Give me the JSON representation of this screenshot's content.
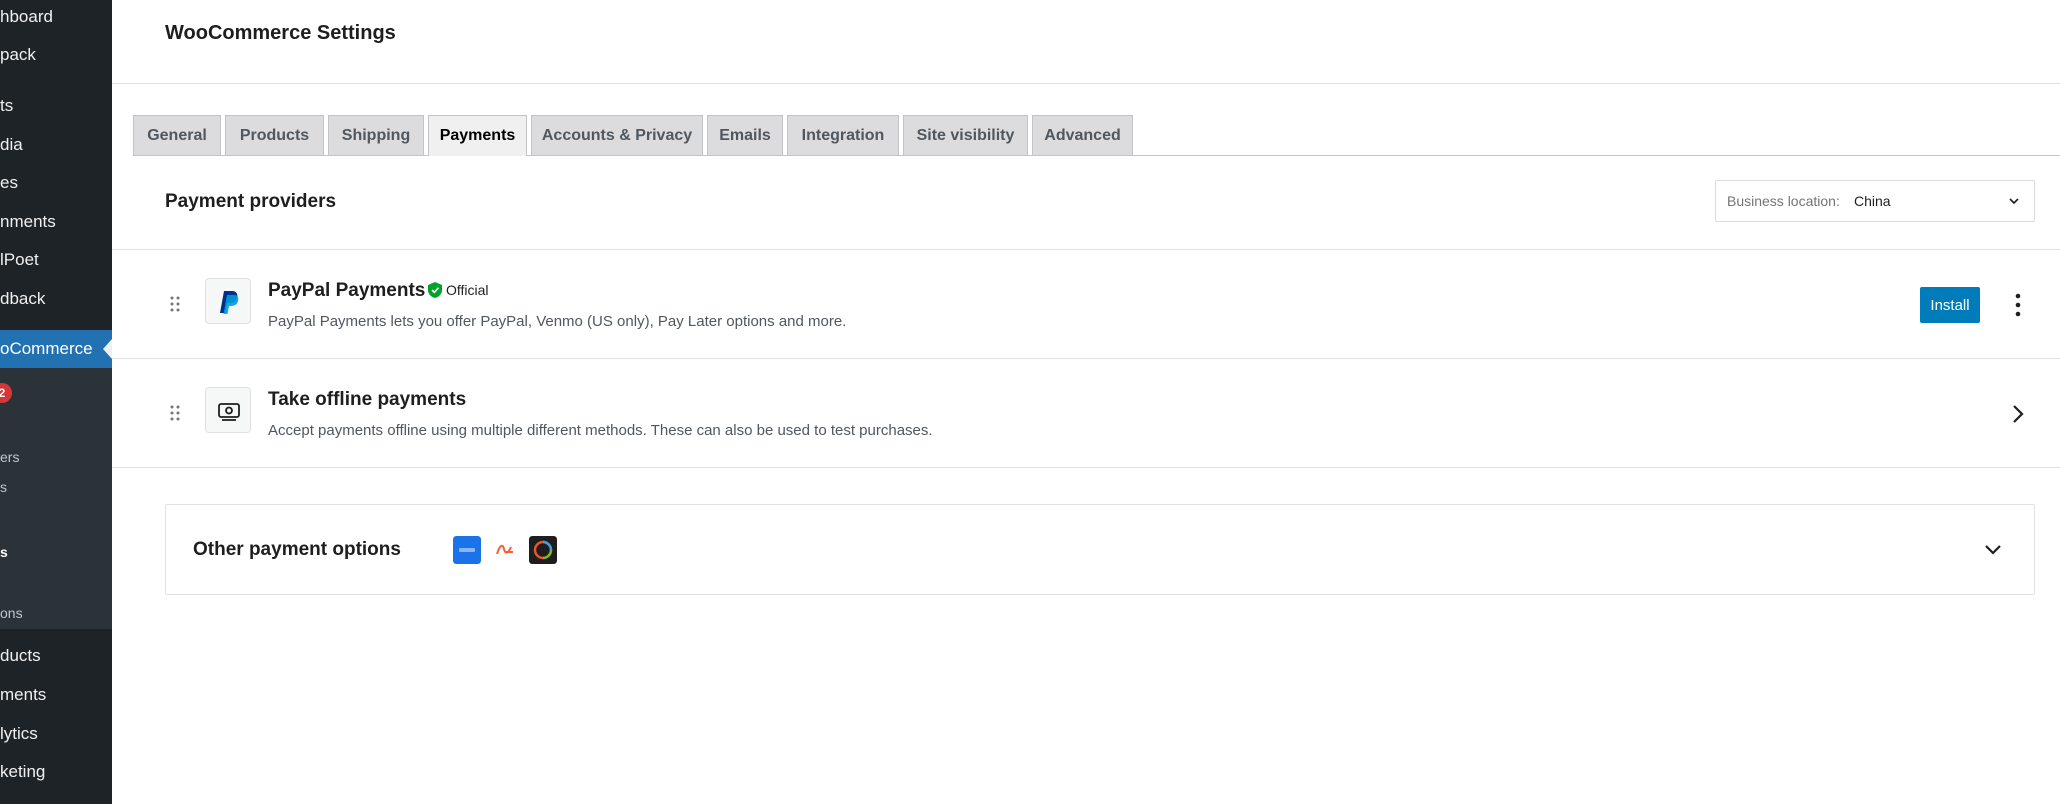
{
  "sidebar": {
    "items": [
      {
        "label": "hboard"
      },
      {
        "label": "pack"
      },
      {
        "label": "ts"
      },
      {
        "label": "dia"
      },
      {
        "label": "es"
      },
      {
        "label": "nments"
      },
      {
        "label": "lPoet"
      },
      {
        "label": "dback"
      },
      {
        "label": "oCommerce"
      },
      {
        "label": "2"
      },
      {
        "label": "ers"
      },
      {
        "label": "s"
      },
      {
        "label": "s"
      },
      {
        "label": "ons"
      },
      {
        "label": "ducts"
      },
      {
        "label": "ments"
      },
      {
        "label": "lytics"
      },
      {
        "label": "keting"
      }
    ]
  },
  "header": {
    "title": "WooCommerce Settings"
  },
  "tabs": [
    {
      "label": "General"
    },
    {
      "label": "Products"
    },
    {
      "label": "Shipping"
    },
    {
      "label": "Payments"
    },
    {
      "label": "Accounts & Privacy"
    },
    {
      "label": "Emails"
    },
    {
      "label": "Integration"
    },
    {
      "label": "Site visibility"
    },
    {
      "label": "Advanced"
    }
  ],
  "active_tab": "Payments",
  "providers": {
    "title": "Payment providers",
    "location_prefix": "Business location:",
    "location_value": "China"
  },
  "paypal": {
    "title": "PayPal Payments",
    "badge": "Official",
    "description": "PayPal Payments lets you offer PayPal, Venmo (US only), Pay Later options and more.",
    "install_label": "Install"
  },
  "offline": {
    "title": "Take offline payments",
    "description": "Accept payments offline using multiple different methods. These can also be used to test purchases."
  },
  "other": {
    "title": "Other payment options"
  },
  "colors": {
    "accent": "#007cba",
    "sidebar_bg": "#1d2327",
    "sidebar_active": "#2271b1",
    "official_green": "#00a32a"
  }
}
